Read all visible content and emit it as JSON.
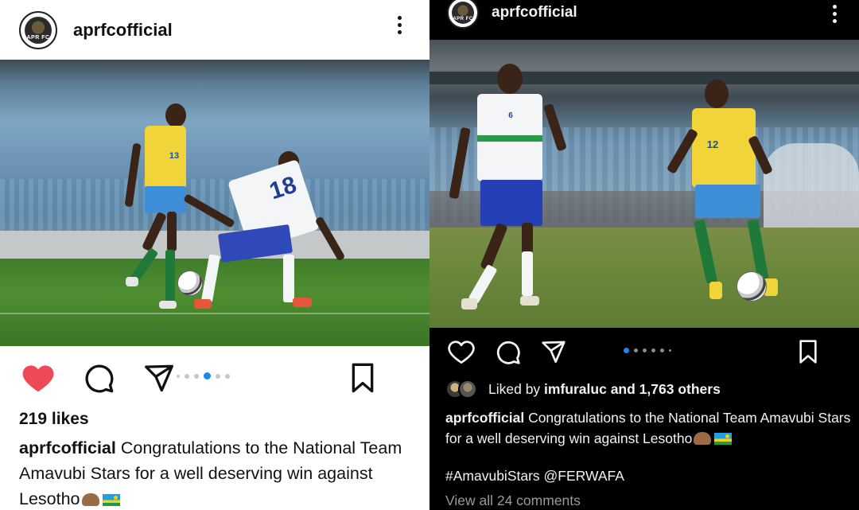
{
  "left_post": {
    "username": "aprfcofficial",
    "avatar_text": "APR FC",
    "likes": "219 likes",
    "caption_user": "aprfcofficial",
    "caption_text": " Congratulations to the National Team Amavubi Stars for a well deserving win against Lesotho",
    "carousel": {
      "count": 6,
      "active_index": 3
    },
    "player_numbers": [
      "13",
      "18"
    ],
    "liked": true,
    "colors": {
      "like": "#ed4956",
      "dot_active": "#1e88e5"
    }
  },
  "right_post": {
    "username": "aprfcofficial",
    "avatar_text": "APR FC",
    "liked_by_prefix": "Liked by ",
    "liked_by_user": "imfuraluc",
    "liked_by_suffix": " and 1,763 others",
    "caption_user": "aprfcofficial",
    "caption_text": " Congratulations to the National Team Amavubi Stars for a well deserving win against Lesotho",
    "hashtags": "#AmavubiStars @FERWAFA",
    "view_comments": "View all 24 comments",
    "carousel": {
      "count": 6,
      "active_index": 0
    },
    "player_numbers": [
      "6",
      "12"
    ]
  }
}
